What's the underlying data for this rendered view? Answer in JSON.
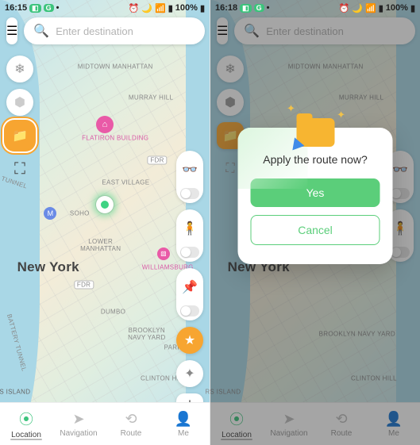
{
  "left": {
    "status": {
      "time": "16:15",
      "battery": "100%"
    },
    "search_placeholder": "Enter destination",
    "labels": {
      "midtown": "MIDTOWN\nMANHATTAN",
      "murray": "MURRAY HILL",
      "flatiron": "Flatiron Building",
      "eastvillage": "EAST VILLAGE",
      "soho": "SOHO",
      "lower": "LOWER\nMANHATTAN",
      "newyork": "New York",
      "williams": "Williamsburg",
      "dumbo": "DUMBO",
      "brooklyn": "BROOKLYN\nNAVY YARD",
      "park": "PARK AVE",
      "clinton": "CLINTON HILL",
      "tunnel": "TUNNEL",
      "battery": "BATTERY TUNNEL",
      "fdr1": "FDR",
      "fdr2": "FDR",
      "rsland": "rs Island"
    },
    "tabs": {
      "location": "Location",
      "navigation": "Navigation",
      "route": "Route",
      "me": "Me"
    }
  },
  "right": {
    "status": {
      "time": "16:18",
      "battery": "100%"
    },
    "search_placeholder": "Enter destination",
    "tabs": {
      "location": "Location",
      "navigation": "Navigation",
      "route": "Route",
      "me": "Me"
    },
    "dialog": {
      "title": "Apply the route now?",
      "yes": "Yes",
      "cancel": "Cancel"
    }
  }
}
